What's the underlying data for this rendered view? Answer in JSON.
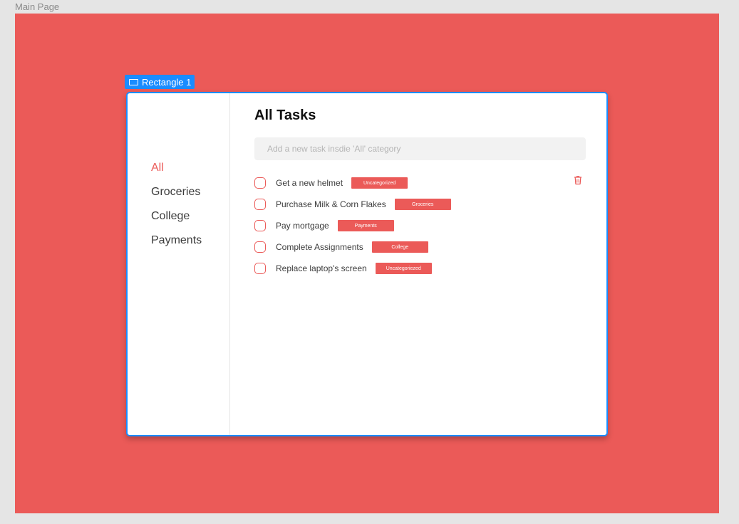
{
  "canvas": {
    "frame_label": "Main Page",
    "frame_color": "#eb5a58",
    "selection": {
      "label": "Rectangle 1",
      "icon": "rectangle-icon",
      "color": "#1a8cff"
    }
  },
  "sidebar": {
    "items": [
      {
        "label": "All",
        "active": true
      },
      {
        "label": "Groceries",
        "active": false
      },
      {
        "label": "College",
        "active": false
      },
      {
        "label": "Payments",
        "active": false
      }
    ]
  },
  "main": {
    "title": "All Tasks",
    "add_placeholder": "Add a new task insdie 'All' category",
    "delete_icon": "trash-icon",
    "tasks": [
      {
        "text": "Get a new helmet",
        "tag": "Uncategorized",
        "checked": false
      },
      {
        "text": "Purchase Milk & Corn Flakes",
        "tag": "Groceries",
        "checked": false
      },
      {
        "text": "Pay mortgage",
        "tag": "Payments",
        "checked": false
      },
      {
        "text": "Complete Assignments",
        "tag": "College",
        "checked": false
      },
      {
        "text": "Replace laptop's screen",
        "tag": "Uncategoriezed",
        "checked": false
      }
    ]
  },
  "colors": {
    "accent": "#eb5a58",
    "selection": "#1a8cff",
    "text": "#3c3c3c",
    "input_bg": "#f2f2f2"
  }
}
